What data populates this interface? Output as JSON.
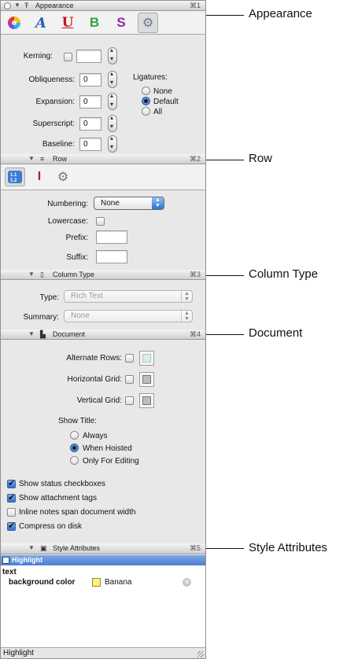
{
  "headers": {
    "appearance": {
      "title": "Appearance",
      "shortcut": "⌘1"
    },
    "row": {
      "title": "Row",
      "shortcut": "⌘2"
    },
    "column_type": {
      "title": "Column Type",
      "shortcut": "⌘3"
    },
    "document": {
      "title": "Document",
      "shortcut": "⌘4"
    },
    "style_attributes": {
      "title": "Style Attributes",
      "shortcut": "⌘5"
    }
  },
  "appearance": {
    "tabs": [
      "colors-icon",
      "fonts-icon",
      "underline-icon",
      "bold-icon",
      "styles-icon",
      "gear-icon"
    ],
    "kerning_label": "Kerning:",
    "obliqueness_label": "Obliqueness:",
    "obliqueness_value": "0",
    "expansion_label": "Expansion:",
    "expansion_value": "0",
    "superscript_label": "Superscript:",
    "superscript_value": "0",
    "baseline_label": "Baseline:",
    "baseline_value": "0",
    "ligatures_label": "Ligatures:",
    "ligatures_options": [
      "None",
      "Default",
      "All"
    ],
    "ligatures_selected": "Default"
  },
  "row": {
    "tabs": [
      "numbering-icon",
      "text-cursor-icon",
      "gear-icon"
    ],
    "numbering_label": "Numbering:",
    "numbering_value": "None",
    "lowercase_label": "Lowercase:",
    "prefix_label": "Prefix:",
    "suffix_label": "Suffix:"
  },
  "column_type": {
    "type_label": "Type:",
    "type_value": "Rich Text",
    "summary_label": "Summary:",
    "summary_value": "None"
  },
  "document": {
    "alternate_rows_label": "Alternate Rows:",
    "horizontal_grid_label": "Horizontal Grid:",
    "vertical_grid_label": "Vertical Grid:",
    "show_title_label": "Show Title:",
    "show_title_options": [
      "Always",
      "When Hoisted",
      "Only For Editing"
    ],
    "show_title_selected": "When Hoisted",
    "checkboxes": [
      {
        "label": "Show status checkboxes",
        "checked": true
      },
      {
        "label": "Show attachment tags",
        "checked": true
      },
      {
        "label": "Inline notes span document width",
        "checked": false
      },
      {
        "label": "Compress on disk",
        "checked": true
      }
    ],
    "colors": {
      "alternate_rows": "#d9efe9",
      "horizontal_grid": "#bdbdbd",
      "vertical_grid": "#bdbdbd"
    }
  },
  "style_attributes": {
    "list_header": "Highlight",
    "group": "text",
    "attribute_label": "background color",
    "attribute_value": "Banana",
    "attribute_color": "#fff176",
    "status": "Highlight"
  },
  "callouts": [
    "Appearance",
    "Row",
    "Column Type",
    "Document",
    "Style Attributes"
  ]
}
